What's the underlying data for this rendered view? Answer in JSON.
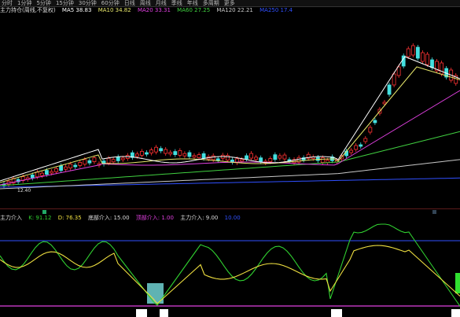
{
  "toolbar": {
    "items": [
      "分时",
      "1分钟",
      "5分钟",
      "15分钟",
      "30分钟",
      "60分钟",
      "日线",
      "周线",
      "月线",
      "季线",
      "年线",
      "多周期",
      "更多"
    ]
  },
  "main_legend": {
    "title": "主力持仓(周线,不复权)",
    "ma5": "MA5 38.83",
    "ma10": "MA10 34.82",
    "ma20": "MA20 33.31",
    "ma60": "MA60 27.25",
    "ma120": "MA120 22.21",
    "ma250": "MA250 17.4"
  },
  "y_label": "12.40",
  "sub_legend": {
    "title": "主力介入",
    "k": "K: 91.12",
    "d": "D: 76.35",
    "l1": "底部介入: 15.00",
    "l2": "顶部介入: 1.00",
    "l3": "主力介入: 9.00",
    "l4": "10.00"
  },
  "colors": {
    "up": "#ff3333",
    "down": "#44e0e0",
    "ma5": "#ffffff",
    "ma10": "#e6e66a",
    "ma20": "#e040e0",
    "ma60": "#40d040",
    "ma120": "#c8c8c8",
    "ma250": "#3050ff",
    "k_line": "#30d030",
    "d_line": "#f0e040",
    "magenta": "#e040e0",
    "blue": "#3050ff"
  }
}
